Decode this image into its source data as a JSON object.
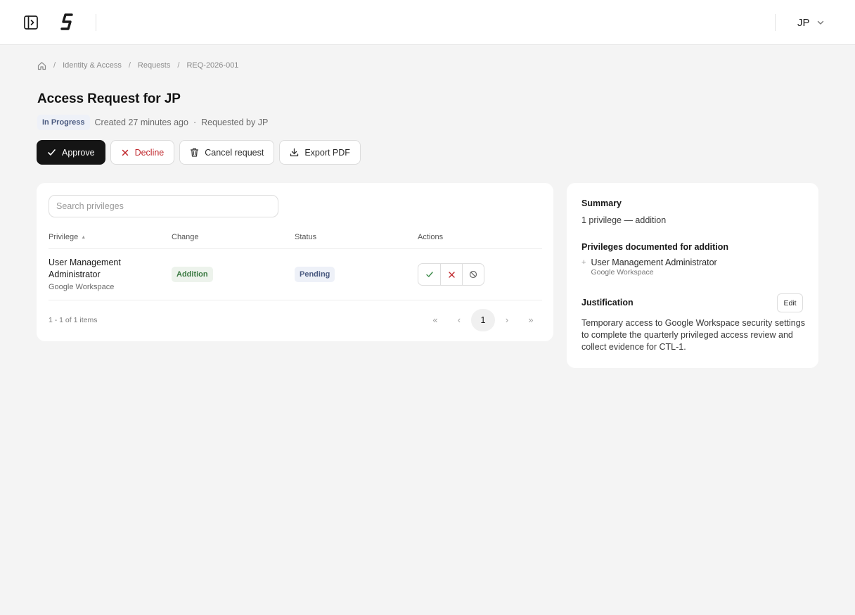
{
  "header": {
    "user_initials": "JP",
    "icons": {
      "panel_toggle": "sidebar-toggle-icon",
      "logo": "brand-logo",
      "user_menu": "chevron-down-icon"
    }
  },
  "breadcrumb": {
    "home_icon": "home-icon",
    "items": [
      "Identity & Access",
      "Requests",
      "REQ-2026-001"
    ],
    "separator": "/"
  },
  "page": {
    "title": "Access Request for JP",
    "status": "In Progress",
    "created": "Created 27 minutes ago",
    "separator": "·",
    "requested_by": "Requested by JP"
  },
  "actions": {
    "approve": "Approve",
    "decline": "Decline",
    "cancel": "Cancel request",
    "export": "Export PDF"
  },
  "table": {
    "search_placeholder": "Search privileges",
    "columns": [
      "Privilege",
      "Change",
      "Status",
      "Actions"
    ],
    "sort_indicator": "▲",
    "rows": [
      {
        "privilege": "User Management Administrator",
        "source": "Google Workspace",
        "change": "Addition",
        "status": "Pending"
      }
    ],
    "footer_count": "1 - 1 of 1 items",
    "pager": {
      "first": "«",
      "prev": "‹",
      "current_page": "1",
      "next": "›",
      "last": "»"
    }
  },
  "summary": {
    "label": "Summary",
    "text": "1 privilege — addition",
    "documented_label": "Privileges documented for addition",
    "items": [
      {
        "marker": "+",
        "name": "User Management Administrator",
        "source": "Google Workspace"
      }
    ],
    "justification_label": "Justification",
    "edit_label": "Edit",
    "justification_text": "Temporary access to Google Workspace security settings to complete the quarterly privileged access review and collect evidence for CTL-1."
  },
  "colors": {
    "primary": "#151515",
    "danger": "#c0282d",
    "success": "#3b7a42",
    "info": "#4a5a80",
    "page_bg": "#f4f4f4"
  }
}
